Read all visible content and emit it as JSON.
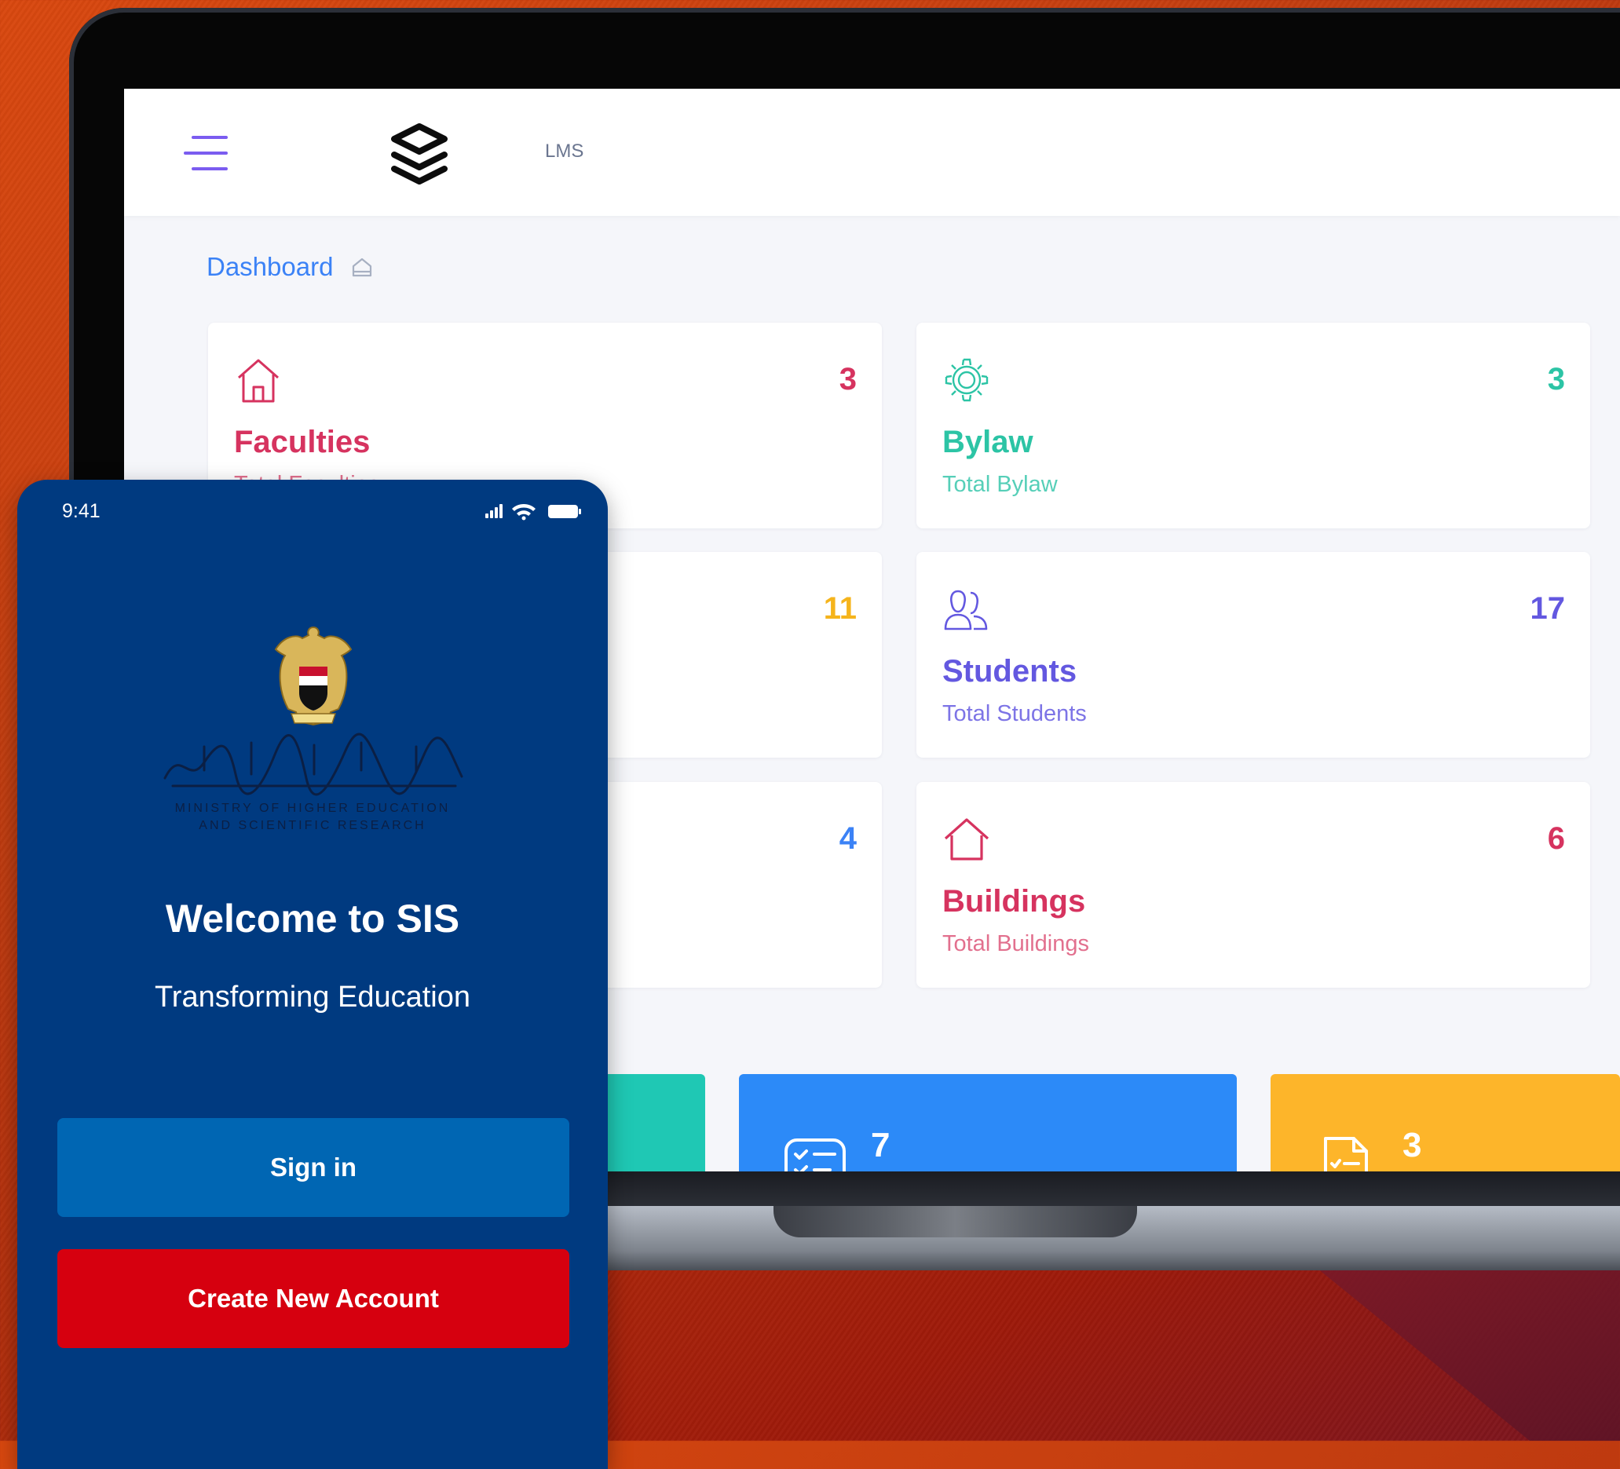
{
  "colors": {
    "background": "#c9420f",
    "accent_purple": "#7b5cf0",
    "phone_bg": "#003a80",
    "signin_btn": "#0066b3",
    "create_btn": "#d6000f",
    "faculties": "#d6335f",
    "bylaw": "#2cc4a5",
    "students": "#6358e0",
    "buildings": "#d6335f",
    "count_11": "#f5b41c",
    "count_4": "#3b82f6",
    "tile_teal": "#1fc8b4",
    "tile_blue": "#2c8af8",
    "tile_yellow": "#fdb52a"
  },
  "laptop": {
    "header": {
      "menu_icon": "hamburger-menu-icon",
      "logo_icon": "stacked-layers-logo",
      "app_label": "LMS"
    },
    "breadcrumb": {
      "label": "Dashboard",
      "icon": "home-outline-icon"
    },
    "cards": [
      {
        "title": "Faculties",
        "subtitle": "Total Faculties",
        "count": "3",
        "icon": "house-icon"
      },
      {
        "title": "Bylaw",
        "subtitle": "Total Bylaw",
        "count": "3",
        "icon": "gear-icon"
      },
      {
        "count": "11"
      },
      {
        "title": "Students",
        "subtitle": "Total Students",
        "count": "17",
        "icon": "users-icon"
      },
      {
        "count": "4"
      },
      {
        "title": "Buildings",
        "subtitle": "Total Buildings",
        "count": "6",
        "icon": "building-icon"
      }
    ],
    "tiles": [
      {
        "count": ""
      },
      {
        "count": "7",
        "icon": "checklist-card-icon"
      },
      {
        "count": "3",
        "icon": "document-check-icon"
      }
    ]
  },
  "phone": {
    "status_time": "9:41",
    "status_icons": "signal-wifi-battery",
    "emblem": "eagle-emblem",
    "ministry_arabic": "وزارة التعليم العالي والبحث العلمي",
    "ministry_english": [
      "MINISTRY OF HIGHER EDUCATION",
      "AND SCIENTIFIC RESEARCH"
    ],
    "welcome": "Welcome to SIS",
    "tagline": "Transforming Education",
    "signin": "Sign in",
    "create_account": "Create New Account"
  }
}
